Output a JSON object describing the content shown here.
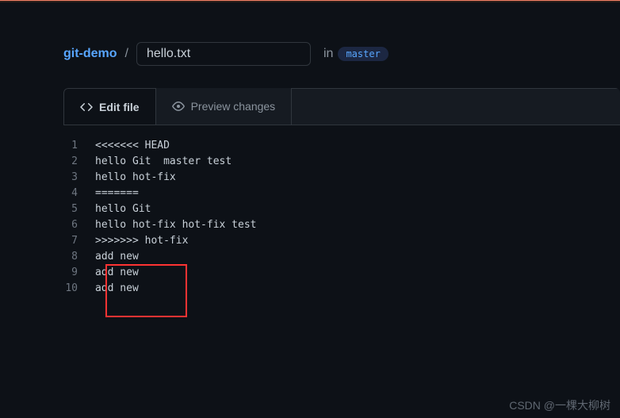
{
  "breadcrumb": {
    "repo": "git-demo",
    "separator": "/",
    "filename": "hello.txt",
    "in_label": "in",
    "branch": "master"
  },
  "tabs": {
    "edit": "Edit file",
    "preview": "Preview changes"
  },
  "editor": {
    "lines": [
      {
        "n": "1",
        "text": "<<<<<<< HEAD"
      },
      {
        "n": "2",
        "text": "hello Git  master test"
      },
      {
        "n": "3",
        "text": "hello hot-fix"
      },
      {
        "n": "4",
        "text": "======="
      },
      {
        "n": "5",
        "text": "hello Git"
      },
      {
        "n": "6",
        "text": "hello hot-fix hot-fix test"
      },
      {
        "n": "7",
        "text": ">>>>>>> hot-fix"
      },
      {
        "n": "8",
        "text": "add new"
      },
      {
        "n": "9",
        "text": "add new"
      },
      {
        "n": "10",
        "text": "add new"
      }
    ]
  },
  "watermark": "CSDN @一棵大柳树"
}
